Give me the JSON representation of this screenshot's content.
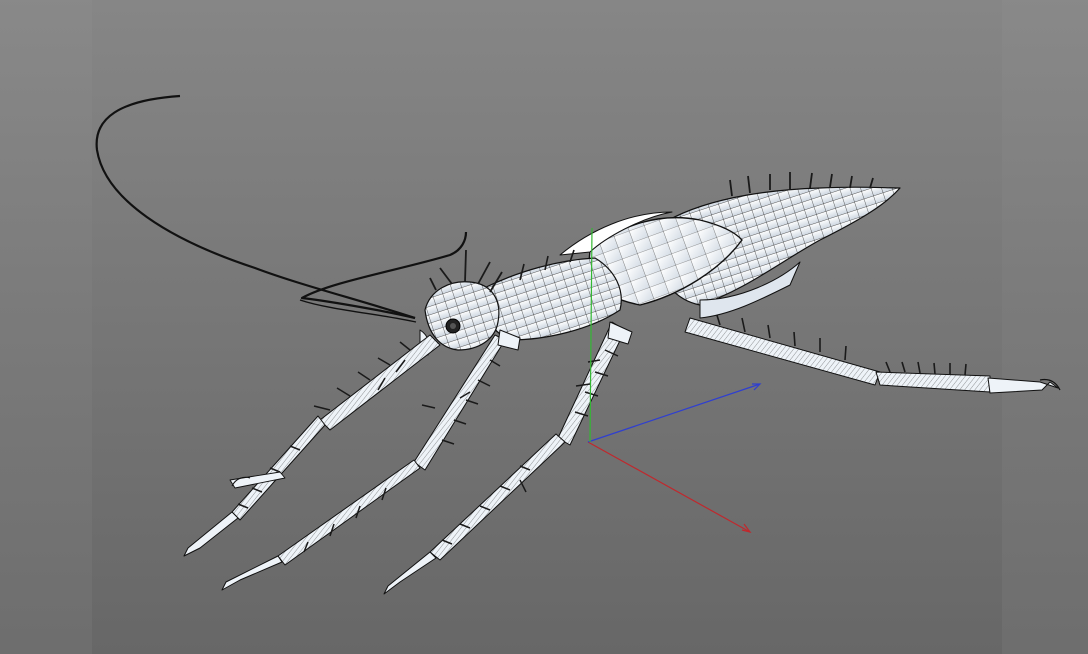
{
  "viewport": {
    "view": "perspective",
    "shading": "wireframe-on-shaded",
    "background_colors": {
      "outer": "#7a7a7a",
      "viewport_top": "#868686",
      "viewport_bottom": "#676767"
    }
  },
  "model": {
    "icon": "insect-model-icon",
    "mesh_color": "#eef3f8",
    "wire_color": "#111111",
    "spike_color": "#1a1a1a"
  },
  "gizmo": {
    "icon": "transform-axis-icon",
    "axes": [
      {
        "axis": "x",
        "color": "#c0282d"
      },
      {
        "axis": "y",
        "color": "#33b833"
      },
      {
        "axis": "z",
        "color": "#2f3fd0"
      }
    ]
  }
}
